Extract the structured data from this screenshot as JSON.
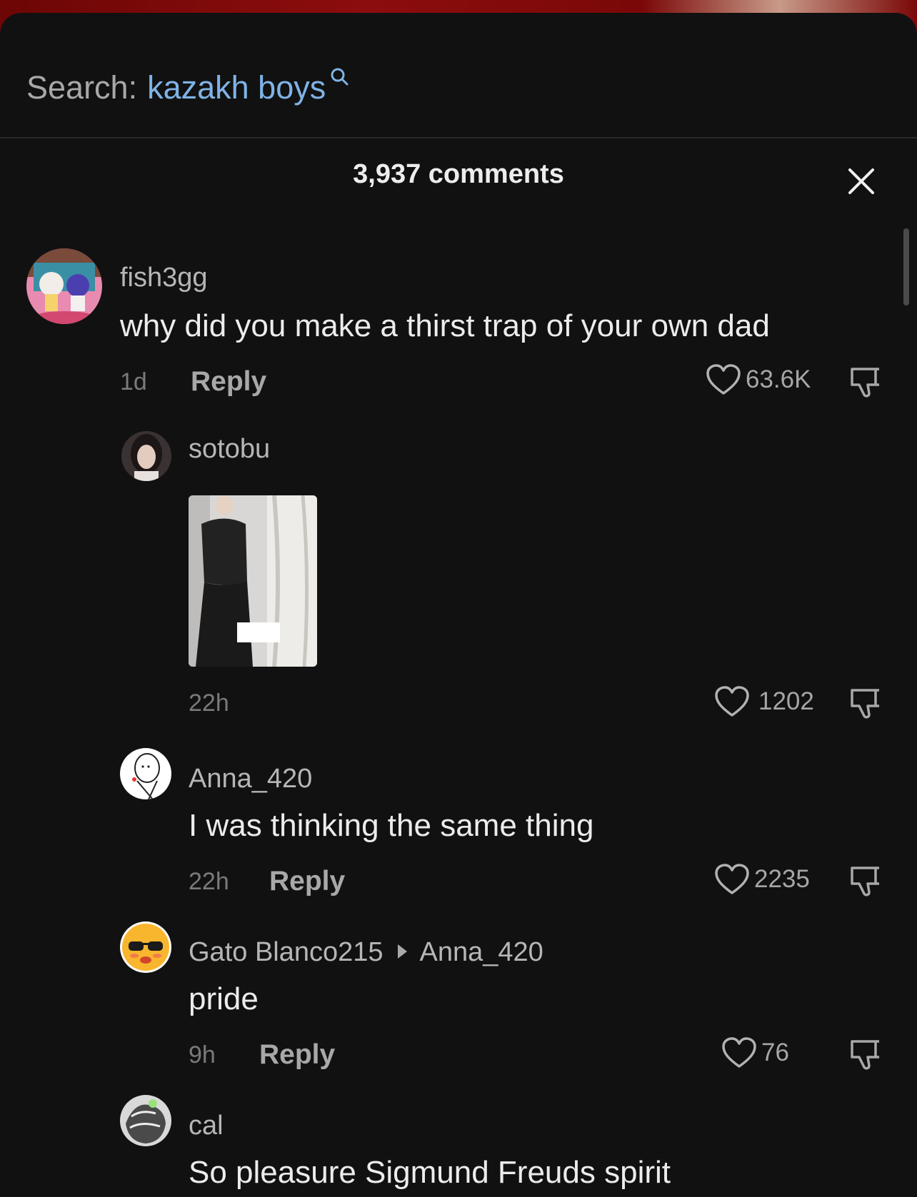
{
  "search": {
    "prefix": "Search:",
    "query": "kazakh boys"
  },
  "header": {
    "comment_count": "3,937 comments"
  },
  "comments": [
    {
      "username": "fish3gg",
      "text": "why did you make a thirst trap of your own dad",
      "time": "1d",
      "reply_label": "Reply",
      "likes": "63.6K"
    },
    {
      "username": "sotobu",
      "time": "22h",
      "likes": "1202"
    },
    {
      "username": "Anna_420",
      "text": "I was thinking the same thing",
      "time": "22h",
      "reply_label": "Reply",
      "likes": "2235"
    },
    {
      "username": "Gato Blanco215",
      "reply_to": "Anna_420",
      "text": "pride",
      "time": "9h",
      "reply_label": "Reply",
      "likes": "76"
    },
    {
      "username": "cal",
      "text": "So pleasure Sigmund Freuds spirit"
    }
  ],
  "colors": {
    "accent_link": "#7fb3e6",
    "background": "#111111",
    "text_primary": "#ececec",
    "text_secondary": "#a8a8a8"
  }
}
